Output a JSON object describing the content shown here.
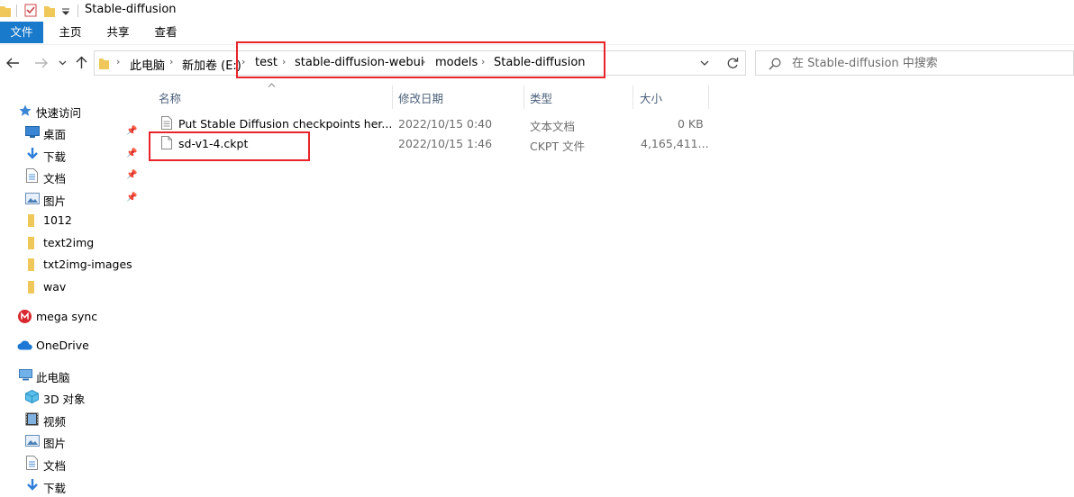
{
  "window": {
    "title": "Stable-diffusion"
  },
  "ribbon": {
    "tabs": [
      {
        "label": "文件",
        "active": true
      },
      {
        "label": "主页"
      },
      {
        "label": "共享"
      },
      {
        "label": "查看"
      }
    ]
  },
  "address": {
    "crumbs": [
      "此电脑",
      "新加卷 (E:)",
      "test",
      "stable-diffusion-webui",
      "models",
      "Stable-diffusion"
    ]
  },
  "search": {
    "placeholder": "在 Stable-diffusion 中搜索"
  },
  "navpane": {
    "quick_access": "快速访问",
    "items": [
      {
        "label": "桌面",
        "icon": "desktop-icon",
        "pinned": true
      },
      {
        "label": "下载",
        "icon": "download-icon",
        "pinned": true
      },
      {
        "label": "文档",
        "icon": "document-icon",
        "pinned": true
      },
      {
        "label": "图片",
        "icon": "pictures-icon",
        "pinned": true
      },
      {
        "label": "1012",
        "icon": "folder-icon"
      },
      {
        "label": "text2img",
        "icon": "folder-icon"
      },
      {
        "label": "txt2img-images",
        "icon": "folder-icon"
      },
      {
        "label": "wav",
        "icon": "folder-icon"
      }
    ],
    "mega": "mega sync",
    "onedrive": "OneDrive",
    "this_pc": "此电脑",
    "pc_items": [
      {
        "label": "3D 对象",
        "icon": "3d-objects-icon"
      },
      {
        "label": "视频",
        "icon": "video-icon"
      },
      {
        "label": "图片",
        "icon": "pictures-icon"
      },
      {
        "label": "文档",
        "icon": "document-icon"
      },
      {
        "label": "下载",
        "icon": "download-icon"
      }
    ]
  },
  "columns": {
    "name": "名称",
    "date": "修改日期",
    "type": "类型",
    "size": "大小"
  },
  "files": [
    {
      "name": "Put Stable Diffusion checkpoints her...",
      "date": "2022/10/15 0:40",
      "type": "文本文档",
      "size": "0 KB"
    },
    {
      "name": "sd-v1-4.ckpt",
      "date": "2022/10/15 1:46",
      "type": "CKPT 文件",
      "size": "4,165,411..."
    }
  ],
  "colors": {
    "accent": "#1979ca",
    "highlight": "#e8242a",
    "folder": "#f0c85a"
  }
}
